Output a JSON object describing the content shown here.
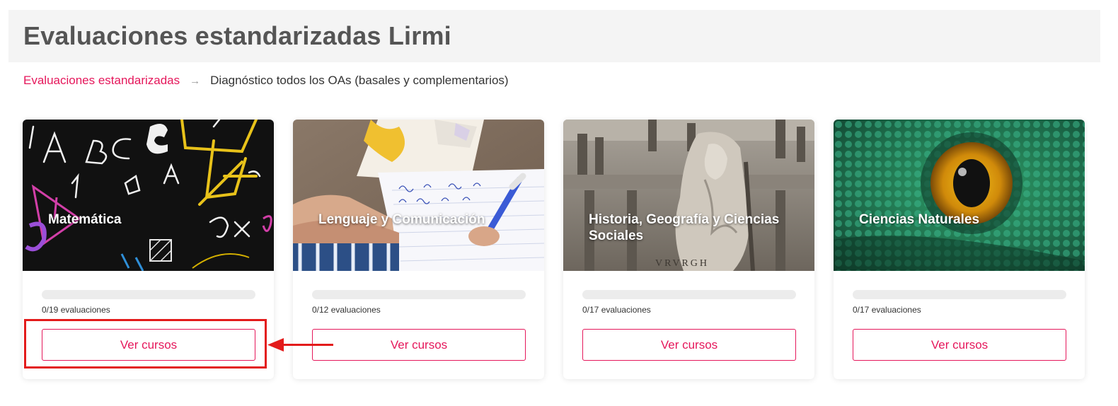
{
  "header": {
    "title": "Evaluaciones estandarizadas Lirmi"
  },
  "breadcrumb": {
    "link": "Evaluaciones estandarizadas",
    "separator": "→",
    "current": "Diagnóstico todos los OAs (basales y complementarios)"
  },
  "colors": {
    "accent": "#e5175b",
    "annotation": "#e31b1b",
    "header_bg": "#f4f4f4"
  },
  "cards": [
    {
      "title": "Matemática",
      "count_text": "0/19 evaluaciones",
      "progress": 0,
      "button": "Ver cursos"
    },
    {
      "title": "Lenguaje y Comunicación",
      "count_text": "0/12 evaluaciones",
      "progress": 0,
      "button": "Ver cursos"
    },
    {
      "title": "Historia, Geografía y Ciencias Sociales",
      "count_text": "0/17 evaluaciones",
      "progress": 0,
      "button": "Ver cursos"
    },
    {
      "title": "Ciencias Naturales",
      "count_text": "0/17 evaluaciones",
      "progress": 0,
      "button": "Ver cursos"
    }
  ]
}
